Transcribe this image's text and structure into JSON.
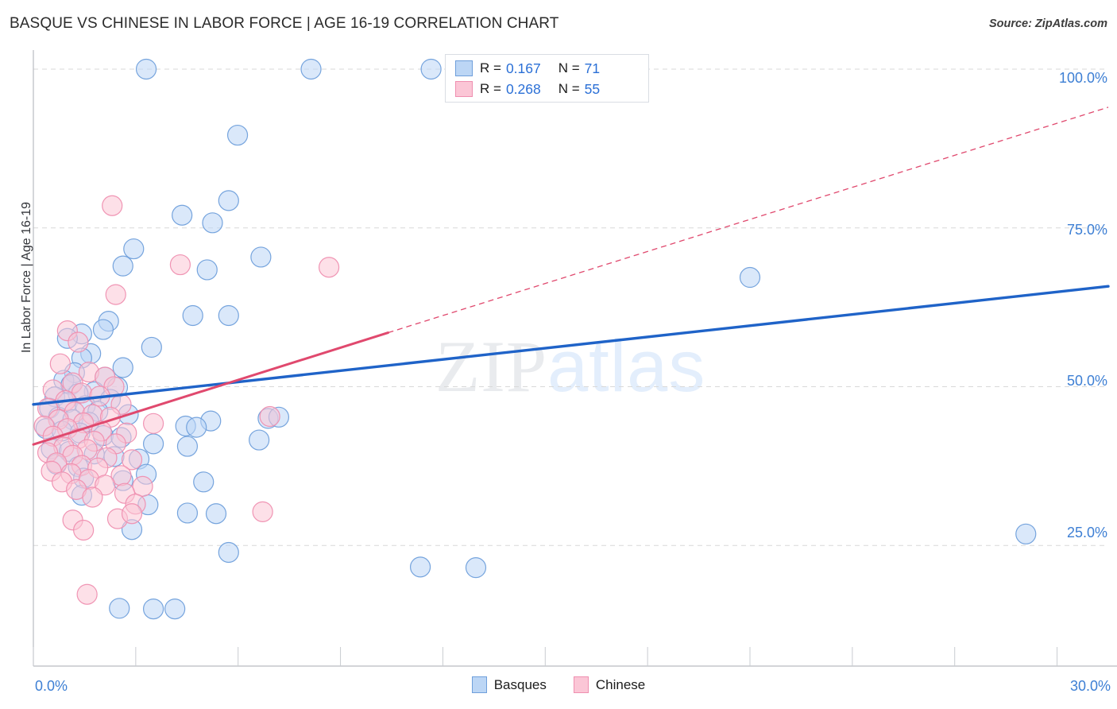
{
  "header": {
    "title": "BASQUE VS CHINESE IN LABOR FORCE | AGE 16-19 CORRELATION CHART",
    "source": "Source: ZipAtlas.com"
  },
  "watermark": {
    "part1": "ZIP",
    "part2": "atlas"
  },
  "stats": {
    "series1": {
      "r_label": "R =",
      "r_value": "0.167",
      "n_label": "N =",
      "n_value": "71"
    },
    "series2": {
      "r_label": "R =",
      "r_value": "0.268",
      "n_label": "N =",
      "n_value": "55"
    }
  },
  "legend": {
    "items": [
      {
        "label": "Basques",
        "color": "#bcd6f5",
        "border": "#6f9fdb"
      },
      {
        "label": "Chinese",
        "color": "#fbc6d6",
        "border": "#ef8fb0"
      }
    ]
  },
  "axes": {
    "y_title": "In Labor Force | Age 16-19",
    "y_ticks": [
      "100.0%",
      "75.0%",
      "50.0%",
      "25.0%"
    ],
    "x_ticks": [
      "0.0%",
      "30.0%"
    ]
  },
  "chart_data": {
    "type": "scatter",
    "title": "BASQUE VS CHINESE IN LABOR FORCE | AGE 16-19 CORRELATION CHART",
    "xlabel": "",
    "ylabel": "In Labor Force | Age 16-19",
    "xlim": [
      0,
      30
    ],
    "ylim": [
      6.0,
      103.0
    ],
    "x_unit": "percent",
    "y_unit": "percent",
    "grid": true,
    "legend_position": "bottom-center",
    "y_gridlines": [
      100.0,
      75.0,
      50.0,
      25.0
    ],
    "series": [
      {
        "name": "Basques",
        "color": "#bcd6f5",
        "border": "#6f9fdb",
        "R": 0.167,
        "N": 71,
        "trend": {
          "style": "solid",
          "x0": 0.0,
          "y0": 47.2,
          "x1": 30.0,
          "y1": 65.8
        },
        "points": [
          [
            3.15,
            100.0
          ],
          [
            7.75,
            100.0
          ],
          [
            11.1,
            100.0
          ],
          [
            13.85,
            100.0
          ],
          [
            5.7,
            89.6
          ],
          [
            5.45,
            79.3
          ],
          [
            4.15,
            77.0
          ],
          [
            5.0,
            75.8
          ],
          [
            2.8,
            71.7
          ],
          [
            6.35,
            70.4
          ],
          [
            2.5,
            69.0
          ],
          [
            4.85,
            68.4
          ],
          [
            20.0,
            67.2
          ],
          [
            4.45,
            61.2
          ],
          [
            5.45,
            61.2
          ],
          [
            2.1,
            60.3
          ],
          [
            1.95,
            59.0
          ],
          [
            1.35,
            58.3
          ],
          [
            0.95,
            57.6
          ],
          [
            3.3,
            56.2
          ],
          [
            1.6,
            55.2
          ],
          [
            1.35,
            54.5
          ],
          [
            2.5,
            53.0
          ],
          [
            1.15,
            52.2
          ],
          [
            2.0,
            51.5
          ],
          [
            0.85,
            51.0
          ],
          [
            1.05,
            50.3
          ],
          [
            2.35,
            49.9
          ],
          [
            1.7,
            49.2
          ],
          [
            1.25,
            48.9
          ],
          [
            0.6,
            48.4
          ],
          [
            2.15,
            48.0
          ],
          [
            0.95,
            47.5
          ],
          [
            1.45,
            47.0
          ],
          [
            0.45,
            46.6
          ],
          [
            1.8,
            46.1
          ],
          [
            2.65,
            45.6
          ],
          [
            0.7,
            45.2
          ],
          [
            1.1,
            44.8
          ],
          [
            1.55,
            44.4
          ],
          [
            6.55,
            45.0
          ],
          [
            6.85,
            45.2
          ],
          [
            4.95,
            44.6
          ],
          [
            4.25,
            43.8
          ],
          [
            4.55,
            43.6
          ],
          [
            0.35,
            43.4
          ],
          [
            0.8,
            43.0
          ],
          [
            1.3,
            42.7
          ],
          [
            1.95,
            42.3
          ],
          [
            2.45,
            42.0
          ],
          [
            6.3,
            41.6
          ],
          [
            3.35,
            41.0
          ],
          [
            4.3,
            40.6
          ],
          [
            0.5,
            40.2
          ],
          [
            1.0,
            39.8
          ],
          [
            1.7,
            39.4
          ],
          [
            2.25,
            39.0
          ],
          [
            2.95,
            38.6
          ],
          [
            0.65,
            37.8
          ],
          [
            1.25,
            37.4
          ],
          [
            3.15,
            36.2
          ],
          [
            1.4,
            35.6
          ],
          [
            2.5,
            35.2
          ],
          [
            4.75,
            35.0
          ],
          [
            1.35,
            32.9
          ],
          [
            3.2,
            31.4
          ],
          [
            4.3,
            30.1
          ],
          [
            5.1,
            30.0
          ],
          [
            2.75,
            27.5
          ],
          [
            5.45,
            23.9
          ],
          [
            10.8,
            21.6
          ],
          [
            12.35,
            21.5
          ],
          [
            2.4,
            15.1
          ],
          [
            3.35,
            15.0
          ],
          [
            3.95,
            15.0
          ],
          [
            27.7,
            26.8
          ]
        ]
      },
      {
        "name": "Chinese",
        "color": "#fbc6d6",
        "border": "#ef8fb0",
        "R": 0.268,
        "N": 55,
        "trend": {
          "style": "solid-then-dashed",
          "x0": 0.0,
          "y0": 40.9,
          "x_solid_end": 9.9,
          "y_solid_end": 58.5,
          "x1": 30.0,
          "y1": 94.0
        },
        "points": [
          [
            2.2,
            78.5
          ],
          [
            4.1,
            69.2
          ],
          [
            8.25,
            68.8
          ],
          [
            2.3,
            64.5
          ],
          [
            0.95,
            58.8
          ],
          [
            1.25,
            57.0
          ],
          [
            0.75,
            53.6
          ],
          [
            1.55,
            52.3
          ],
          [
            2.0,
            51.5
          ],
          [
            1.1,
            50.6
          ],
          [
            2.25,
            50.0
          ],
          [
            0.55,
            49.5
          ],
          [
            1.35,
            49.0
          ],
          [
            1.85,
            48.5
          ],
          [
            0.9,
            47.8
          ],
          [
            2.45,
            47.2
          ],
          [
            0.4,
            46.6
          ],
          [
            1.15,
            46.0
          ],
          [
            1.65,
            45.6
          ],
          [
            2.15,
            45.2
          ],
          [
            0.7,
            44.8
          ],
          [
            1.4,
            44.3
          ],
          [
            3.35,
            44.2
          ],
          [
            6.6,
            45.3
          ],
          [
            0.3,
            43.8
          ],
          [
            0.95,
            43.4
          ],
          [
            1.9,
            43.0
          ],
          [
            2.6,
            42.7
          ],
          [
            0.55,
            42.2
          ],
          [
            1.25,
            41.8
          ],
          [
            1.7,
            41.4
          ],
          [
            2.3,
            41.0
          ],
          [
            0.85,
            40.5
          ],
          [
            1.5,
            40.1
          ],
          [
            0.4,
            39.6
          ],
          [
            1.1,
            39.2
          ],
          [
            2.05,
            38.8
          ],
          [
            2.75,
            38.5
          ],
          [
            0.65,
            38.0
          ],
          [
            1.35,
            37.6
          ],
          [
            1.8,
            37.2
          ],
          [
            0.5,
            36.7
          ],
          [
            1.05,
            36.3
          ],
          [
            2.45,
            36.0
          ],
          [
            1.55,
            35.4
          ],
          [
            0.8,
            35.0
          ],
          [
            2.0,
            34.5
          ],
          [
            3.05,
            34.3
          ],
          [
            1.2,
            33.8
          ],
          [
            2.55,
            33.2
          ],
          [
            1.65,
            32.6
          ],
          [
            2.85,
            31.5
          ],
          [
            6.4,
            30.3
          ],
          [
            1.1,
            29.0
          ],
          [
            2.35,
            29.2
          ],
          [
            2.75,
            30.0
          ],
          [
            1.4,
            27.4
          ],
          [
            1.5,
            17.3
          ]
        ]
      }
    ]
  }
}
